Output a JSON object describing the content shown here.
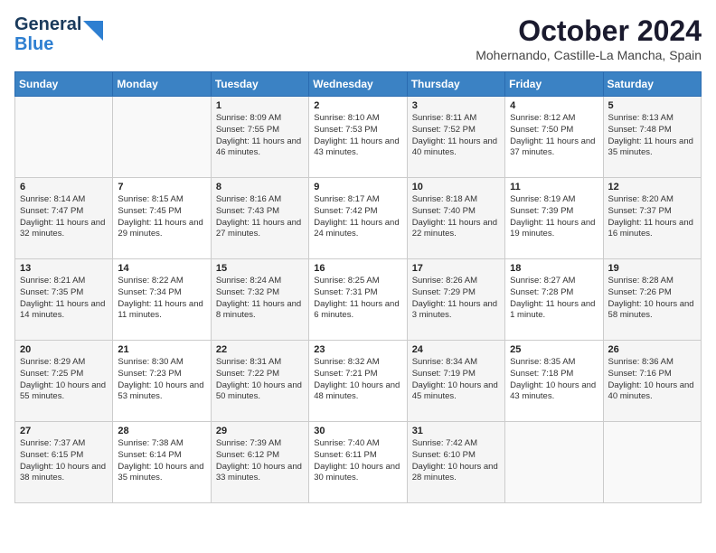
{
  "header": {
    "logo": {
      "line1": "General",
      "line2": "Blue"
    },
    "month": "October 2024",
    "location": "Mohernando, Castille-La Mancha, Spain"
  },
  "weekdays": [
    "Sunday",
    "Monday",
    "Tuesday",
    "Wednesday",
    "Thursday",
    "Friday",
    "Saturday"
  ],
  "weeks": [
    [
      {
        "day": "",
        "info": ""
      },
      {
        "day": "",
        "info": ""
      },
      {
        "day": "1",
        "info": "Sunrise: 8:09 AM\nSunset: 7:55 PM\nDaylight: 11 hours and 46 minutes."
      },
      {
        "day": "2",
        "info": "Sunrise: 8:10 AM\nSunset: 7:53 PM\nDaylight: 11 hours and 43 minutes."
      },
      {
        "day": "3",
        "info": "Sunrise: 8:11 AM\nSunset: 7:52 PM\nDaylight: 11 hours and 40 minutes."
      },
      {
        "day": "4",
        "info": "Sunrise: 8:12 AM\nSunset: 7:50 PM\nDaylight: 11 hours and 37 minutes."
      },
      {
        "day": "5",
        "info": "Sunrise: 8:13 AM\nSunset: 7:48 PM\nDaylight: 11 hours and 35 minutes."
      }
    ],
    [
      {
        "day": "6",
        "info": "Sunrise: 8:14 AM\nSunset: 7:47 PM\nDaylight: 11 hours and 32 minutes."
      },
      {
        "day": "7",
        "info": "Sunrise: 8:15 AM\nSunset: 7:45 PM\nDaylight: 11 hours and 29 minutes."
      },
      {
        "day": "8",
        "info": "Sunrise: 8:16 AM\nSunset: 7:43 PM\nDaylight: 11 hours and 27 minutes."
      },
      {
        "day": "9",
        "info": "Sunrise: 8:17 AM\nSunset: 7:42 PM\nDaylight: 11 hours and 24 minutes."
      },
      {
        "day": "10",
        "info": "Sunrise: 8:18 AM\nSunset: 7:40 PM\nDaylight: 11 hours and 22 minutes."
      },
      {
        "day": "11",
        "info": "Sunrise: 8:19 AM\nSunset: 7:39 PM\nDaylight: 11 hours and 19 minutes."
      },
      {
        "day": "12",
        "info": "Sunrise: 8:20 AM\nSunset: 7:37 PM\nDaylight: 11 hours and 16 minutes."
      }
    ],
    [
      {
        "day": "13",
        "info": "Sunrise: 8:21 AM\nSunset: 7:35 PM\nDaylight: 11 hours and 14 minutes."
      },
      {
        "day": "14",
        "info": "Sunrise: 8:22 AM\nSunset: 7:34 PM\nDaylight: 11 hours and 11 minutes."
      },
      {
        "day": "15",
        "info": "Sunrise: 8:24 AM\nSunset: 7:32 PM\nDaylight: 11 hours and 8 minutes."
      },
      {
        "day": "16",
        "info": "Sunrise: 8:25 AM\nSunset: 7:31 PM\nDaylight: 11 hours and 6 minutes."
      },
      {
        "day": "17",
        "info": "Sunrise: 8:26 AM\nSunset: 7:29 PM\nDaylight: 11 hours and 3 minutes."
      },
      {
        "day": "18",
        "info": "Sunrise: 8:27 AM\nSunset: 7:28 PM\nDaylight: 11 hours and 1 minute."
      },
      {
        "day": "19",
        "info": "Sunrise: 8:28 AM\nSunset: 7:26 PM\nDaylight: 10 hours and 58 minutes."
      }
    ],
    [
      {
        "day": "20",
        "info": "Sunrise: 8:29 AM\nSunset: 7:25 PM\nDaylight: 10 hours and 55 minutes."
      },
      {
        "day": "21",
        "info": "Sunrise: 8:30 AM\nSunset: 7:23 PM\nDaylight: 10 hours and 53 minutes."
      },
      {
        "day": "22",
        "info": "Sunrise: 8:31 AM\nSunset: 7:22 PM\nDaylight: 10 hours and 50 minutes."
      },
      {
        "day": "23",
        "info": "Sunrise: 8:32 AM\nSunset: 7:21 PM\nDaylight: 10 hours and 48 minutes."
      },
      {
        "day": "24",
        "info": "Sunrise: 8:34 AM\nSunset: 7:19 PM\nDaylight: 10 hours and 45 minutes."
      },
      {
        "day": "25",
        "info": "Sunrise: 8:35 AM\nSunset: 7:18 PM\nDaylight: 10 hours and 43 minutes."
      },
      {
        "day": "26",
        "info": "Sunrise: 8:36 AM\nSunset: 7:16 PM\nDaylight: 10 hours and 40 minutes."
      }
    ],
    [
      {
        "day": "27",
        "info": "Sunrise: 7:37 AM\nSunset: 6:15 PM\nDaylight: 10 hours and 38 minutes."
      },
      {
        "day": "28",
        "info": "Sunrise: 7:38 AM\nSunset: 6:14 PM\nDaylight: 10 hours and 35 minutes."
      },
      {
        "day": "29",
        "info": "Sunrise: 7:39 AM\nSunset: 6:12 PM\nDaylight: 10 hours and 33 minutes."
      },
      {
        "day": "30",
        "info": "Sunrise: 7:40 AM\nSunset: 6:11 PM\nDaylight: 10 hours and 30 minutes."
      },
      {
        "day": "31",
        "info": "Sunrise: 7:42 AM\nSunset: 6:10 PM\nDaylight: 10 hours and 28 minutes."
      },
      {
        "day": "",
        "info": ""
      },
      {
        "day": "",
        "info": ""
      }
    ]
  ]
}
